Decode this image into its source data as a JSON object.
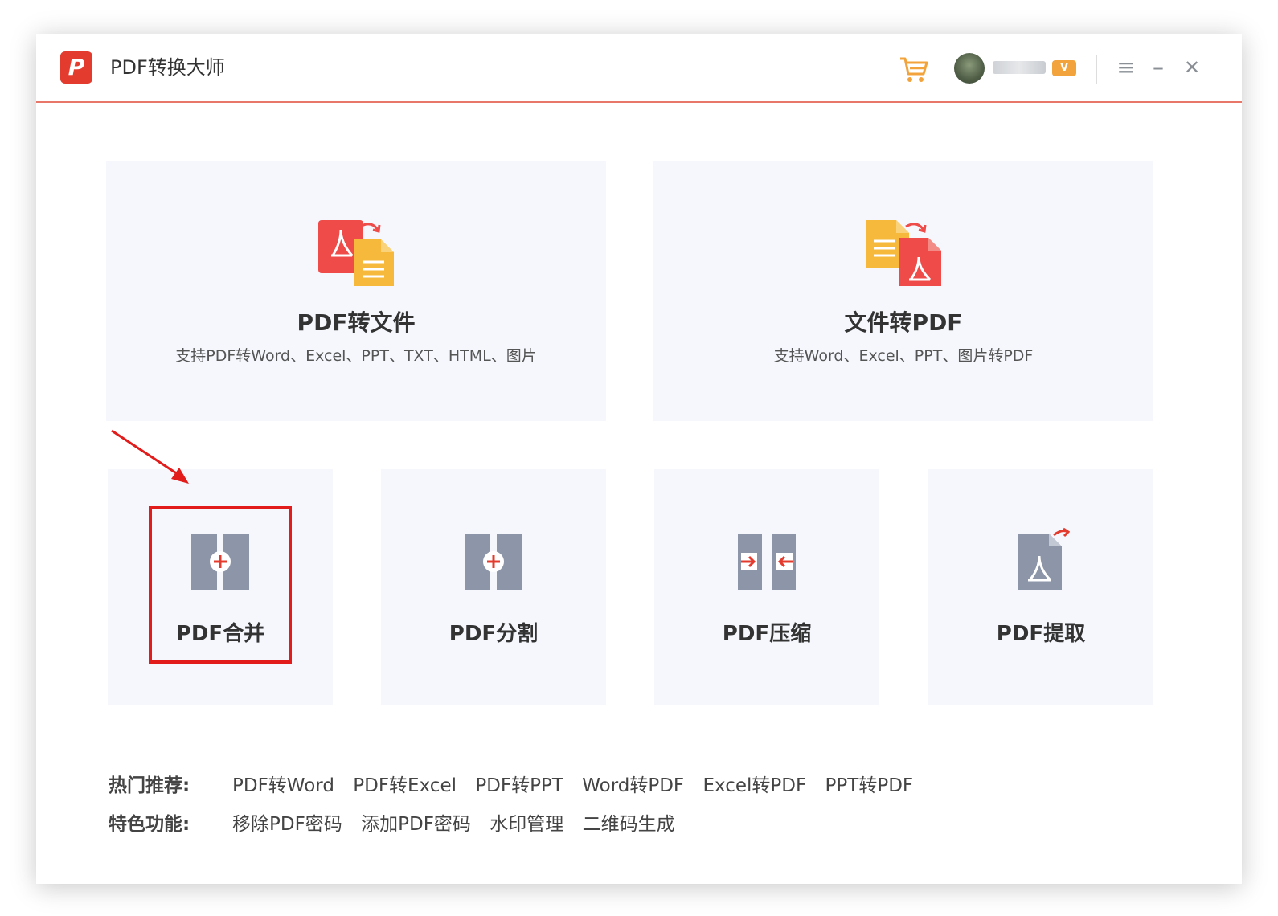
{
  "app": {
    "title": "PDF转换大师",
    "logo_letter": "P"
  },
  "titlebar": {
    "vip_badge": "V",
    "menu_icon": "≡",
    "minimize_icon": "–",
    "close_icon": "✕"
  },
  "cards": {
    "pdf_to_file": {
      "title": "PDF转文件",
      "desc": "支持PDF转Word、Excel、PPT、TXT、HTML、图片"
    },
    "file_to_pdf": {
      "title": "文件转PDF",
      "desc": "支持Word、Excel、PPT、图片转PDF"
    },
    "tools": [
      {
        "title": "PDF合并"
      },
      {
        "title": "PDF分割"
      },
      {
        "title": "PDF压缩"
      },
      {
        "title": "PDF提取"
      }
    ]
  },
  "footer": {
    "hot_label": "热门推荐:",
    "hot_links": [
      "PDF转Word",
      "PDF转Excel",
      "PDF转PPT",
      "Word转PDF",
      "Excel转PDF",
      "PPT转PDF"
    ],
    "feature_label": "特色功能:",
    "feature_links": [
      "移除PDF密码",
      "添加PDF密码",
      "水印管理",
      "二维码生成"
    ]
  },
  "colors": {
    "accent": "#e33c2f",
    "highlight": "#e21b1b",
    "card_bg": "#f5f7fc",
    "icon_gray": "#8c96a8",
    "file_orange": "#f6b93b"
  }
}
